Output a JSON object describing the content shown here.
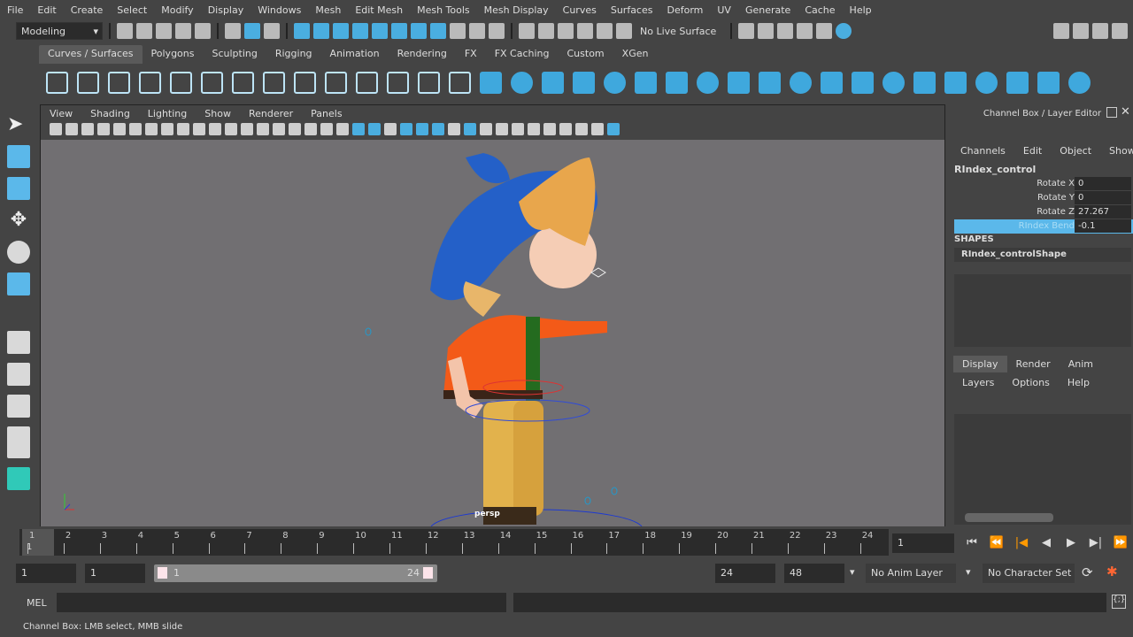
{
  "menu": [
    "File",
    "Edit",
    "Create",
    "Select",
    "Modify",
    "Display",
    "Windows",
    "Mesh",
    "Edit Mesh",
    "Mesh Tools",
    "Mesh Display",
    "Curves",
    "Surfaces",
    "Deform",
    "UV",
    "Generate",
    "Cache",
    "Help"
  ],
  "status": {
    "mode": "Modeling",
    "live_surface": "No Live Surface"
  },
  "shelf_tabs": [
    "Curves / Surfaces",
    "Polygons",
    "Sculpting",
    "Rigging",
    "Animation",
    "Rendering",
    "FX",
    "FX Caching",
    "Custom",
    "XGen"
  ],
  "viewport": {
    "menu": [
      "View",
      "Shading",
      "Lighting",
      "Show",
      "Renderer",
      "Panels"
    ],
    "camera": "persp"
  },
  "channel_box": {
    "title": "Channel Box / Layer Editor",
    "menu": [
      "Channels",
      "Edit",
      "Object",
      "Show"
    ],
    "object": "RIndex_control",
    "channels": [
      {
        "name": "Rotate X",
        "value": "0"
      },
      {
        "name": "Rotate Y",
        "value": "0"
      },
      {
        "name": "Rotate Z",
        "value": "27.267"
      },
      {
        "name": "RIndex Bend",
        "value": "-0.1"
      }
    ],
    "shapes_label": "SHAPES",
    "shape": "RIndex_controlShape",
    "layer_tabs": [
      "Display",
      "Render",
      "Anim"
    ],
    "layer_menu": [
      "Layers",
      "Options",
      "Help"
    ]
  },
  "timeline": {
    "ticks": [
      "1",
      "2",
      "3",
      "4",
      "5",
      "6",
      "7",
      "8",
      "9",
      "10",
      "11",
      "12",
      "13",
      "14",
      "15",
      "16",
      "17",
      "18",
      "19",
      "20",
      "21",
      "22",
      "23",
      "24"
    ],
    "current": "1",
    "current_field": "1"
  },
  "range": {
    "start": "1",
    "playback_start": "1",
    "slider_start": "1",
    "slider_end": "24",
    "playback_end": "24",
    "end": "48",
    "anim_layer": "No Anim Layer",
    "character_set": "No Character Set"
  },
  "command": {
    "label": "MEL"
  },
  "help_line": "Channel Box: LMB select, MMB slide",
  "colors": {
    "accent": "#5bb8ea",
    "viewport_bg": "#716f72"
  }
}
